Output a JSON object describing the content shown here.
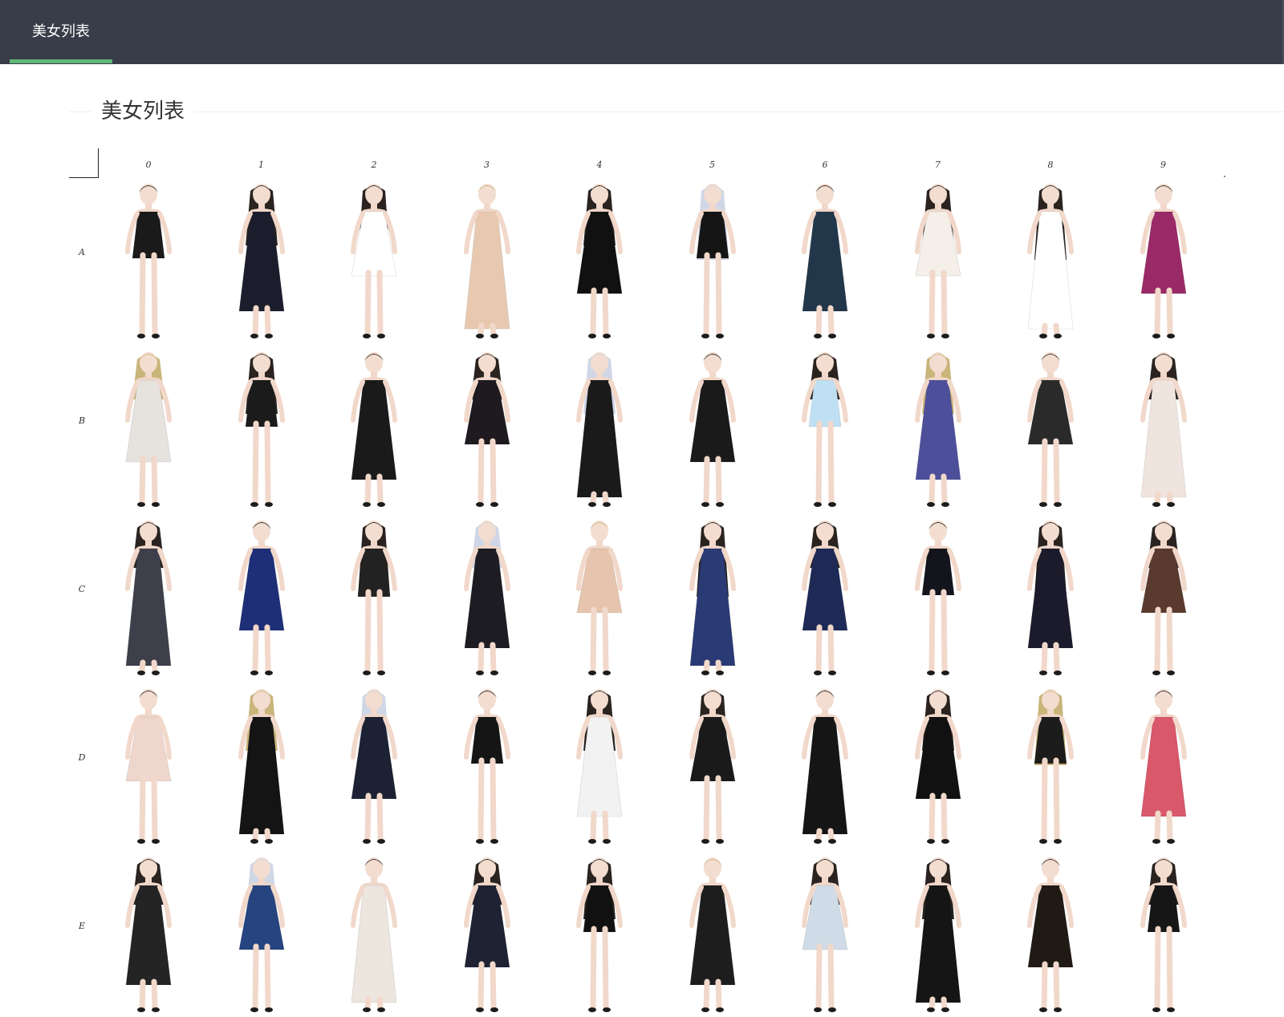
{
  "nav": {
    "tab_label": "美女列表",
    "active_color": "#5fb878",
    "bar_color": "#393d49"
  },
  "section": {
    "title": "美女列表"
  },
  "grid": {
    "columns": [
      "0",
      "1",
      "2",
      "3",
      "4",
      "5",
      "6",
      "7",
      "8",
      "9"
    ],
    "rows": [
      {
        "label": "A",
        "outfit_colors": [
          "#1a1a1a",
          "#1c1d2c",
          "#ffffff",
          "#e8c9b0",
          "#111111",
          "#151515",
          "#22374a",
          "#f4efe9",
          "#ffffff",
          "#9a2a67"
        ]
      },
      {
        "label": "B",
        "outfit_colors": [
          "#e6e2de",
          "#1b1b1b",
          "#1a1a1a",
          "#1e1a1f",
          "#1a1a1a",
          "#1a1a1a",
          "#bfe0f2",
          "#4e4f9a",
          "#2a2a2a",
          "#f0e4df"
        ]
      },
      {
        "label": "C",
        "outfit_colors": [
          "#3d3f4a",
          "#1e2f77",
          "#222222",
          "#1c1c22",
          "#e6c4ad",
          "#2a3a75",
          "#1e2a55",
          "#14141c",
          "#1b1b2c",
          "#5a3a2e"
        ]
      },
      {
        "label": "D",
        "outfit_colors": [
          "#efd6cc",
          "#141414",
          "#1c2133",
          "#151515",
          "#f2f2f2",
          "#1a1a1a",
          "#151515",
          "#111111",
          "#1c1c1c",
          "#d9586a"
        ]
      },
      {
        "label": "E",
        "outfit_colors": [
          "#242424",
          "#26447f",
          "#ece6df",
          "#1e2233",
          "#111111",
          "#1d1d1d",
          "#cfdbe6",
          "#151515",
          "#1f1a14",
          "#161616"
        ]
      }
    ]
  }
}
